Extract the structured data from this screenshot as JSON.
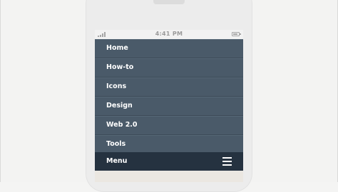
{
  "status_bar": {
    "time": "4:41 PM",
    "signal_icon": "signal-bars-icon",
    "battery_icon": "battery-icon"
  },
  "nav_menu": {
    "items": [
      {
        "label": "Home"
      },
      {
        "label": "How-to"
      },
      {
        "label": "Icons"
      },
      {
        "label": "Design"
      },
      {
        "label": "Web 2.0"
      },
      {
        "label": "Tools"
      }
    ]
  },
  "menu_bar": {
    "label": "Menu",
    "toggle_icon": "hamburger-icon"
  },
  "colors": {
    "menu_item_bg": "#4a5a69",
    "menu_bar_bg": "#253240",
    "page_bg": "#f3f3f2"
  }
}
